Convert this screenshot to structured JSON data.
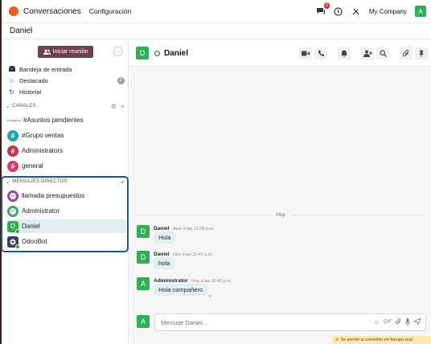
{
  "navbar": {
    "app_name": "Conversaciones",
    "menu_label": "Configuración",
    "notification_count": "3",
    "company": "My Company",
    "user_initial": "A"
  },
  "subheader": {
    "title": "Daniel"
  },
  "sidebar": {
    "start_meeting": "Iniciar reunión",
    "mailboxes": [
      {
        "label": "Bandeja de entrada",
        "icon": "inbox-icon"
      },
      {
        "label": "Destacado",
        "icon": "star-icon",
        "count": "2"
      },
      {
        "label": "Historial",
        "icon": "history-icon"
      }
    ],
    "channels_label": "CANALES",
    "channels": [
      {
        "label": "#Asuntos pendientes",
        "avatar_text": "Instagram"
      },
      {
        "label": "#Grupo ventas",
        "color": "#1fa3a3"
      },
      {
        "label": "Administrators",
        "color": "#c8344a"
      },
      {
        "label": "general",
        "color": "#d63a6c"
      }
    ],
    "dm_label": "MENSAJES DIRECTOS",
    "direct_messages": [
      {
        "label": "llamada presupuestos",
        "color": "#9b3fb5",
        "icon": "bot-avatar-icon"
      },
      {
        "label": "Administrator",
        "color": "#3fa372",
        "icon": "bot-avatar-icon"
      },
      {
        "label": "Daniel",
        "color": "#2eaf54",
        "initial": "D",
        "active": true
      },
      {
        "label": "OdooBot",
        "color": "#3d3d5c",
        "icon": "odoobot-icon"
      }
    ]
  },
  "thread": {
    "name": "Daniel",
    "avatar_initial": "D"
  },
  "messages": {
    "day_separator": "Hoy",
    "items": [
      {
        "author": "Daniel",
        "time": "Ayer a las 11:28 p.m.",
        "text": "Hola",
        "initial": "D"
      },
      {
        "author": "Daniel",
        "time": "Hoy a las 11:41 p.m.",
        "text": "hola",
        "initial": "D"
      },
      {
        "author": "Administrator",
        "time": "Hoy a las 11:42 p.m.",
        "text": "Hola compañero",
        "initial": "A"
      }
    ]
  },
  "composer": {
    "placeholder": "Mensaje Daniel...",
    "avatar_initial": "A"
  },
  "connection_warning": "⚠ Se perdió la conexión en tiempo real."
}
